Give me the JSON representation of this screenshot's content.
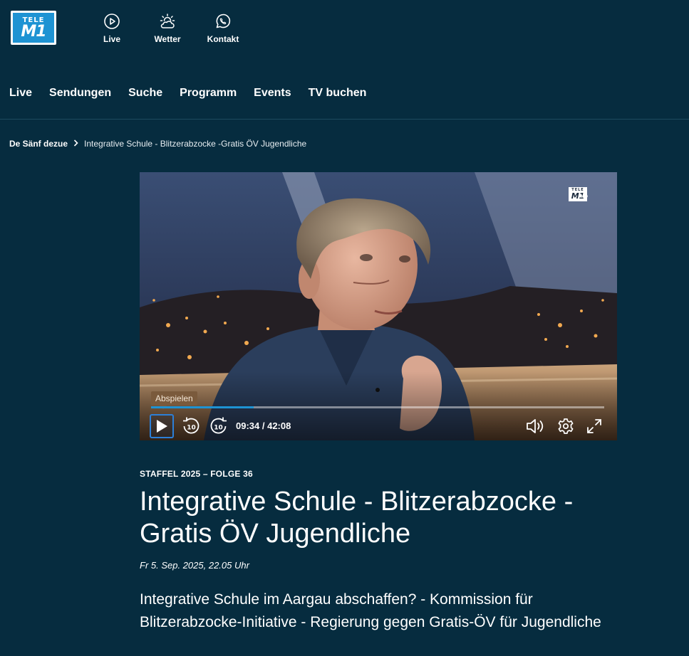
{
  "header": {
    "logo": {
      "line1": "TELE",
      "line2": "M1"
    },
    "icons": [
      {
        "label": "Live",
        "icon": "play-circle-icon"
      },
      {
        "label": "Wetter",
        "icon": "weather-sun-cloud-icon"
      },
      {
        "label": "Kontakt",
        "icon": "whatsapp-icon"
      }
    ]
  },
  "nav": {
    "items": [
      "Live",
      "Sendungen",
      "Suche",
      "Programm",
      "Events",
      "TV buchen"
    ]
  },
  "breadcrumb": {
    "parent": "De Sänf dezue",
    "current": "Integrative Schule - Blitzerabzocke -Gratis ÖV Jugendliche"
  },
  "player": {
    "tooltip": "Abspielen",
    "time": "09:34 / 42:08",
    "progress_fraction": 0.227,
    "rewind_seconds": "10",
    "forward_seconds": "10",
    "channel_bug": {
      "line1": "TELE",
      "line2": "M1",
      "hd": "HD"
    },
    "controls": [
      "play-icon",
      "rewind-10-icon",
      "forward-10-icon",
      "volume-icon",
      "settings-gear-icon",
      "fullscreen-icon"
    ]
  },
  "episode": {
    "season_label": "STAFFEL 2025 – FOLGE 36",
    "title": "Integrative Schule - Blitzerabzocke -Gratis ÖV Jugendliche",
    "date": "Fr 5. Sep. 2025, 22.05 Uhr",
    "lead": "Integrative Schule im Aargau abschaffen? - Kommission für Blitzerabzocke-Initiative - Regierung gegen Gratis-ÖV für Jugendliche"
  },
  "colors": {
    "background": "#062c3f",
    "accent": "#1e93d3",
    "focus": "#2c7fd8"
  }
}
